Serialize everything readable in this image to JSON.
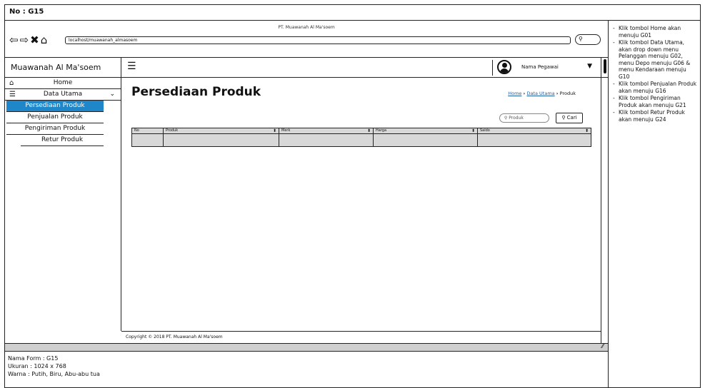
{
  "page": {
    "form_no": "No : G15"
  },
  "browser": {
    "title": "PT. Muawanah Al Ma'soem",
    "url": "localhost/muawanah_almasoem"
  },
  "app": {
    "brand": "Muawanah Al Ma'soem",
    "user_name": "Nama Pegawai"
  },
  "sidebar": {
    "items": [
      {
        "label": "Home",
        "icon": "home-icon"
      },
      {
        "label": "Data Utama",
        "icon": "database-icon"
      },
      {
        "label": "Persediaan Produk"
      },
      {
        "label": "Penjualan Produk"
      },
      {
        "label": "Pengiriman Produk"
      },
      {
        "label": "Retur Produk"
      }
    ]
  },
  "main": {
    "title": "Persediaan Produk",
    "breadcrumb": {
      "home": "Home",
      "data": "Data Utama",
      "current": "Produk"
    },
    "search": {
      "placeholder": "Produk",
      "button": "Cari"
    },
    "table": {
      "columns": [
        "No",
        "Produk",
        "Merk",
        "Harga",
        "Saldo"
      ]
    },
    "footer": "Copyright © 2018 PT. Muawanah Al Ma'soem"
  },
  "info": {
    "lines": [
      "Nama Form : G15",
      "Ukuran : 1024 x 768",
      "Warna : Putih, Biru, Abu-abu tua"
    ]
  },
  "notes": [
    "Klik tombol Home akan menuju G01",
    "Klik tombol Data Utama, akan drop down menu Pelanggan menuju G02, menu Depo menuju G06 & menu Kendaraan menuju G10",
    "Klik tombol Penjualan Produk akan menuju G16",
    "Klik tombol Pengiriman Produk akan menuju G21",
    "Klik tombol Retur Produk akan menuju G24"
  ],
  "colors": {
    "accent": "#1f86c9",
    "table_fill": "#d8d8d8",
    "link": "#1f5fa8"
  }
}
